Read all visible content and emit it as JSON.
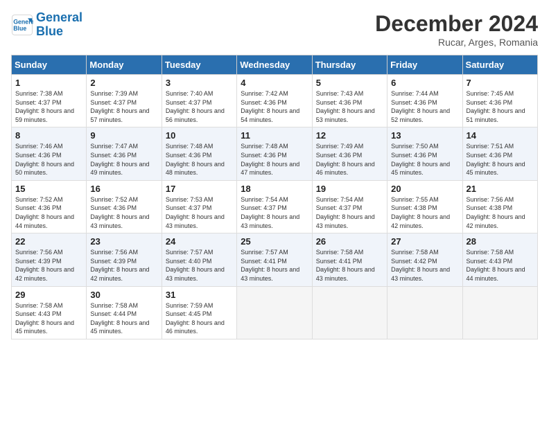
{
  "logo": {
    "line1": "General",
    "line2": "Blue"
  },
  "title": "December 2024",
  "subtitle": "Rucar, Arges, Romania",
  "weekdays": [
    "Sunday",
    "Monday",
    "Tuesday",
    "Wednesday",
    "Thursday",
    "Friday",
    "Saturday"
  ],
  "weeks": [
    [
      {
        "day": "1",
        "sunrise": "7:38 AM",
        "sunset": "4:37 PM",
        "daylight": "8 hours and 59 minutes."
      },
      {
        "day": "2",
        "sunrise": "7:39 AM",
        "sunset": "4:37 PM",
        "daylight": "8 hours and 57 minutes."
      },
      {
        "day": "3",
        "sunrise": "7:40 AM",
        "sunset": "4:37 PM",
        "daylight": "8 hours and 56 minutes."
      },
      {
        "day": "4",
        "sunrise": "7:42 AM",
        "sunset": "4:36 PM",
        "daylight": "8 hours and 54 minutes."
      },
      {
        "day": "5",
        "sunrise": "7:43 AM",
        "sunset": "4:36 PM",
        "daylight": "8 hours and 53 minutes."
      },
      {
        "day": "6",
        "sunrise": "7:44 AM",
        "sunset": "4:36 PM",
        "daylight": "8 hours and 52 minutes."
      },
      {
        "day": "7",
        "sunrise": "7:45 AM",
        "sunset": "4:36 PM",
        "daylight": "8 hours and 51 minutes."
      }
    ],
    [
      {
        "day": "8",
        "sunrise": "7:46 AM",
        "sunset": "4:36 PM",
        "daylight": "8 hours and 50 minutes."
      },
      {
        "day": "9",
        "sunrise": "7:47 AM",
        "sunset": "4:36 PM",
        "daylight": "8 hours and 49 minutes."
      },
      {
        "day": "10",
        "sunrise": "7:48 AM",
        "sunset": "4:36 PM",
        "daylight": "8 hours and 48 minutes."
      },
      {
        "day": "11",
        "sunrise": "7:48 AM",
        "sunset": "4:36 PM",
        "daylight": "8 hours and 47 minutes."
      },
      {
        "day": "12",
        "sunrise": "7:49 AM",
        "sunset": "4:36 PM",
        "daylight": "8 hours and 46 minutes."
      },
      {
        "day": "13",
        "sunrise": "7:50 AM",
        "sunset": "4:36 PM",
        "daylight": "8 hours and 45 minutes."
      },
      {
        "day": "14",
        "sunrise": "7:51 AM",
        "sunset": "4:36 PM",
        "daylight": "8 hours and 45 minutes."
      }
    ],
    [
      {
        "day": "15",
        "sunrise": "7:52 AM",
        "sunset": "4:36 PM",
        "daylight": "8 hours and 44 minutes."
      },
      {
        "day": "16",
        "sunrise": "7:52 AM",
        "sunset": "4:36 PM",
        "daylight": "8 hours and 43 minutes."
      },
      {
        "day": "17",
        "sunrise": "7:53 AM",
        "sunset": "4:37 PM",
        "daylight": "8 hours and 43 minutes."
      },
      {
        "day": "18",
        "sunrise": "7:54 AM",
        "sunset": "4:37 PM",
        "daylight": "8 hours and 43 minutes."
      },
      {
        "day": "19",
        "sunrise": "7:54 AM",
        "sunset": "4:37 PM",
        "daylight": "8 hours and 43 minutes."
      },
      {
        "day": "20",
        "sunrise": "7:55 AM",
        "sunset": "4:38 PM",
        "daylight": "8 hours and 42 minutes."
      },
      {
        "day": "21",
        "sunrise": "7:56 AM",
        "sunset": "4:38 PM",
        "daylight": "8 hours and 42 minutes."
      }
    ],
    [
      {
        "day": "22",
        "sunrise": "7:56 AM",
        "sunset": "4:39 PM",
        "daylight": "8 hours and 42 minutes."
      },
      {
        "day": "23",
        "sunrise": "7:56 AM",
        "sunset": "4:39 PM",
        "daylight": "8 hours and 42 minutes."
      },
      {
        "day": "24",
        "sunrise": "7:57 AM",
        "sunset": "4:40 PM",
        "daylight": "8 hours and 43 minutes."
      },
      {
        "day": "25",
        "sunrise": "7:57 AM",
        "sunset": "4:41 PM",
        "daylight": "8 hours and 43 minutes."
      },
      {
        "day": "26",
        "sunrise": "7:58 AM",
        "sunset": "4:41 PM",
        "daylight": "8 hours and 43 minutes."
      },
      {
        "day": "27",
        "sunrise": "7:58 AM",
        "sunset": "4:42 PM",
        "daylight": "8 hours and 43 minutes."
      },
      {
        "day": "28",
        "sunrise": "7:58 AM",
        "sunset": "4:43 PM",
        "daylight": "8 hours and 44 minutes."
      }
    ],
    [
      {
        "day": "29",
        "sunrise": "7:58 AM",
        "sunset": "4:43 PM",
        "daylight": "8 hours and 45 minutes."
      },
      {
        "day": "30",
        "sunrise": "7:58 AM",
        "sunset": "4:44 PM",
        "daylight": "8 hours and 45 minutes."
      },
      {
        "day": "31",
        "sunrise": "7:59 AM",
        "sunset": "4:45 PM",
        "daylight": "8 hours and 46 minutes."
      },
      null,
      null,
      null,
      null
    ]
  ],
  "labels": {
    "sunrise": "Sunrise:",
    "sunset": "Sunset:",
    "daylight": "Daylight:"
  }
}
